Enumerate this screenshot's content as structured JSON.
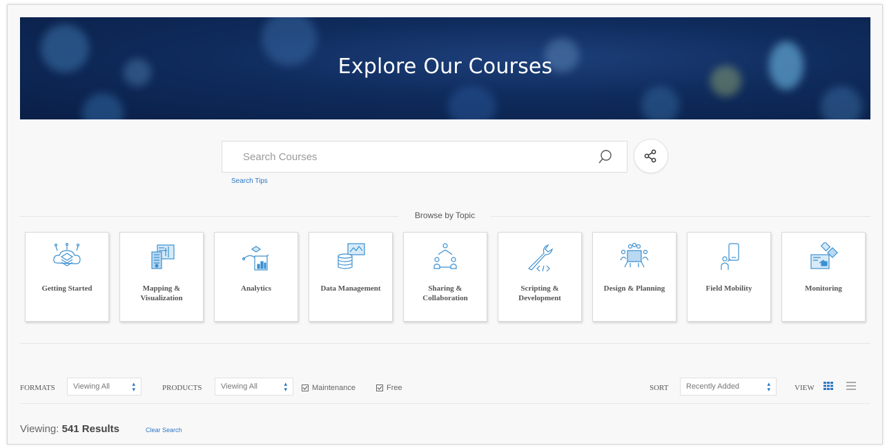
{
  "hero": {
    "title": "Explore Our Courses"
  },
  "search": {
    "placeholder": "Search Courses",
    "tips_label": "Search Tips"
  },
  "browse": {
    "label": "Browse by Topic",
    "topics": [
      {
        "label": "Getting Started",
        "icon": "getting-started-icon"
      },
      {
        "label": "Mapping & Visualization",
        "icon": "mapping-icon"
      },
      {
        "label": "Analytics",
        "icon": "analytics-icon"
      },
      {
        "label": "Data Management",
        "icon": "data-management-icon"
      },
      {
        "label": "Sharing & Collaboration",
        "icon": "sharing-icon"
      },
      {
        "label": "Scripting & Development",
        "icon": "scripting-icon"
      },
      {
        "label": "Design & Planning",
        "icon": "design-icon"
      },
      {
        "label": "Field Mobility",
        "icon": "field-mobility-icon"
      },
      {
        "label": "Monitoring",
        "icon": "satellite-icon"
      }
    ]
  },
  "filters": {
    "formats_label": "FORMATS",
    "formats_value": "Viewing All",
    "products_label": "PRODUCTS",
    "products_value": "Viewing All",
    "maintenance_label": "Maintenance",
    "free_label": "Free",
    "sort_label": "SORT",
    "sort_value": "Recently Added",
    "view_label": "VIEW"
  },
  "results": {
    "prefix": "Viewing:",
    "count_text": "541 Results",
    "clear_label": "Clear Search"
  },
  "colors": {
    "accent": "#2b77c5",
    "hero": "#0f2b5c",
    "icon": "#3a8fd0"
  }
}
